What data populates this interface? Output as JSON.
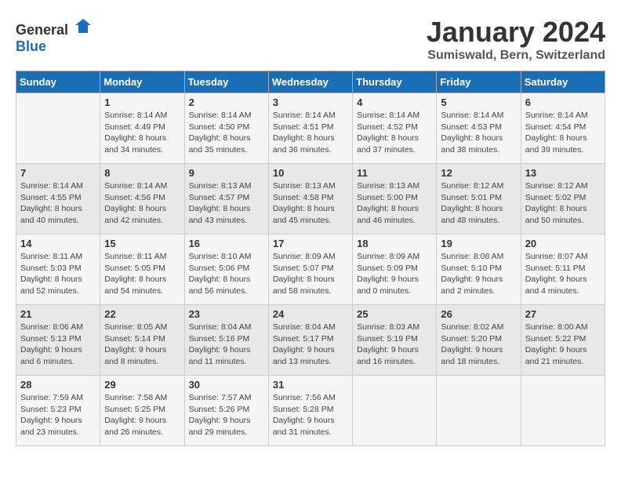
{
  "logo": {
    "general": "General",
    "blue": "Blue"
  },
  "title": "January 2024",
  "location": "Sumiswald, Bern, Switzerland",
  "days_of_week": [
    "Sunday",
    "Monday",
    "Tuesday",
    "Wednesday",
    "Thursday",
    "Friday",
    "Saturday"
  ],
  "weeks": [
    [
      {
        "day": "",
        "sunrise": "",
        "sunset": "",
        "daylight": ""
      },
      {
        "day": "1",
        "sunrise": "Sunrise: 8:14 AM",
        "sunset": "Sunset: 4:49 PM",
        "daylight": "Daylight: 8 hours and 34 minutes."
      },
      {
        "day": "2",
        "sunrise": "Sunrise: 8:14 AM",
        "sunset": "Sunset: 4:50 PM",
        "daylight": "Daylight: 8 hours and 35 minutes."
      },
      {
        "day": "3",
        "sunrise": "Sunrise: 8:14 AM",
        "sunset": "Sunset: 4:51 PM",
        "daylight": "Daylight: 8 hours and 36 minutes."
      },
      {
        "day": "4",
        "sunrise": "Sunrise: 8:14 AM",
        "sunset": "Sunset: 4:52 PM",
        "daylight": "Daylight: 8 hours and 37 minutes."
      },
      {
        "day": "5",
        "sunrise": "Sunrise: 8:14 AM",
        "sunset": "Sunset: 4:53 PM",
        "daylight": "Daylight: 8 hours and 38 minutes."
      },
      {
        "day": "6",
        "sunrise": "Sunrise: 8:14 AM",
        "sunset": "Sunset: 4:54 PM",
        "daylight": "Daylight: 8 hours and 39 minutes."
      }
    ],
    [
      {
        "day": "7",
        "sunrise": "Sunrise: 8:14 AM",
        "sunset": "Sunset: 4:55 PM",
        "daylight": "Daylight: 8 hours and 40 minutes."
      },
      {
        "day": "8",
        "sunrise": "Sunrise: 8:14 AM",
        "sunset": "Sunset: 4:56 PM",
        "daylight": "Daylight: 8 hours and 42 minutes."
      },
      {
        "day": "9",
        "sunrise": "Sunrise: 8:13 AM",
        "sunset": "Sunset: 4:57 PM",
        "daylight": "Daylight: 8 hours and 43 minutes."
      },
      {
        "day": "10",
        "sunrise": "Sunrise: 8:13 AM",
        "sunset": "Sunset: 4:58 PM",
        "daylight": "Daylight: 8 hours and 45 minutes."
      },
      {
        "day": "11",
        "sunrise": "Sunrise: 8:13 AM",
        "sunset": "Sunset: 5:00 PM",
        "daylight": "Daylight: 8 hours and 46 minutes."
      },
      {
        "day": "12",
        "sunrise": "Sunrise: 8:12 AM",
        "sunset": "Sunset: 5:01 PM",
        "daylight": "Daylight: 8 hours and 48 minutes."
      },
      {
        "day": "13",
        "sunrise": "Sunrise: 8:12 AM",
        "sunset": "Sunset: 5:02 PM",
        "daylight": "Daylight: 8 hours and 50 minutes."
      }
    ],
    [
      {
        "day": "14",
        "sunrise": "Sunrise: 8:11 AM",
        "sunset": "Sunset: 5:03 PM",
        "daylight": "Daylight: 8 hours and 52 minutes."
      },
      {
        "day": "15",
        "sunrise": "Sunrise: 8:11 AM",
        "sunset": "Sunset: 5:05 PM",
        "daylight": "Daylight: 8 hours and 54 minutes."
      },
      {
        "day": "16",
        "sunrise": "Sunrise: 8:10 AM",
        "sunset": "Sunset: 5:06 PM",
        "daylight": "Daylight: 8 hours and 56 minutes."
      },
      {
        "day": "17",
        "sunrise": "Sunrise: 8:09 AM",
        "sunset": "Sunset: 5:07 PM",
        "daylight": "Daylight: 8 hours and 58 minutes."
      },
      {
        "day": "18",
        "sunrise": "Sunrise: 8:09 AM",
        "sunset": "Sunset: 5:09 PM",
        "daylight": "Daylight: 9 hours and 0 minutes."
      },
      {
        "day": "19",
        "sunrise": "Sunrise: 8:08 AM",
        "sunset": "Sunset: 5:10 PM",
        "daylight": "Daylight: 9 hours and 2 minutes."
      },
      {
        "day": "20",
        "sunrise": "Sunrise: 8:07 AM",
        "sunset": "Sunset: 5:11 PM",
        "daylight": "Daylight: 9 hours and 4 minutes."
      }
    ],
    [
      {
        "day": "21",
        "sunrise": "Sunrise: 8:06 AM",
        "sunset": "Sunset: 5:13 PM",
        "daylight": "Daylight: 9 hours and 6 minutes."
      },
      {
        "day": "22",
        "sunrise": "Sunrise: 8:05 AM",
        "sunset": "Sunset: 5:14 PM",
        "daylight": "Daylight: 9 hours and 8 minutes."
      },
      {
        "day": "23",
        "sunrise": "Sunrise: 8:04 AM",
        "sunset": "Sunset: 5:16 PM",
        "daylight": "Daylight: 9 hours and 11 minutes."
      },
      {
        "day": "24",
        "sunrise": "Sunrise: 8:04 AM",
        "sunset": "Sunset: 5:17 PM",
        "daylight": "Daylight: 9 hours and 13 minutes."
      },
      {
        "day": "25",
        "sunrise": "Sunrise: 8:03 AM",
        "sunset": "Sunset: 5:19 PM",
        "daylight": "Daylight: 9 hours and 16 minutes."
      },
      {
        "day": "26",
        "sunrise": "Sunrise: 8:02 AM",
        "sunset": "Sunset: 5:20 PM",
        "daylight": "Daylight: 9 hours and 18 minutes."
      },
      {
        "day": "27",
        "sunrise": "Sunrise: 8:00 AM",
        "sunset": "Sunset: 5:22 PM",
        "daylight": "Daylight: 9 hours and 21 minutes."
      }
    ],
    [
      {
        "day": "28",
        "sunrise": "Sunrise: 7:59 AM",
        "sunset": "Sunset: 5:23 PM",
        "daylight": "Daylight: 9 hours and 23 minutes."
      },
      {
        "day": "29",
        "sunrise": "Sunrise: 7:58 AM",
        "sunset": "Sunset: 5:25 PM",
        "daylight": "Daylight: 9 hours and 26 minutes."
      },
      {
        "day": "30",
        "sunrise": "Sunrise: 7:57 AM",
        "sunset": "Sunset: 5:26 PM",
        "daylight": "Daylight: 9 hours and 29 minutes."
      },
      {
        "day": "31",
        "sunrise": "Sunrise: 7:56 AM",
        "sunset": "Sunset: 5:28 PM",
        "daylight": "Daylight: 9 hours and 31 minutes."
      },
      {
        "day": "",
        "sunrise": "",
        "sunset": "",
        "daylight": ""
      },
      {
        "day": "",
        "sunrise": "",
        "sunset": "",
        "daylight": ""
      },
      {
        "day": "",
        "sunrise": "",
        "sunset": "",
        "daylight": ""
      }
    ]
  ]
}
